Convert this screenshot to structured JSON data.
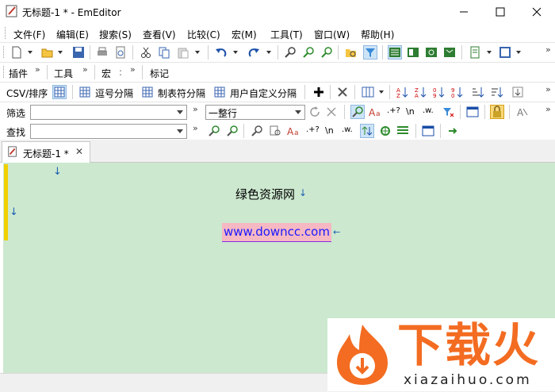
{
  "window": {
    "title": "无标题-1 * - EmEditor"
  },
  "menu": [
    "文件(F)",
    "编辑(E)",
    "搜索(S)",
    "查看(V)",
    "比较(C)",
    "宏(M)",
    "工具(T)",
    "窗口(W)",
    "帮助(H)"
  ],
  "toolbar3": {
    "plugins": "插件",
    "tools": "工具",
    "macro": "宏",
    "marks": "标记"
  },
  "csvbar": {
    "csv_sort": "CSV/排序",
    "comma": "逗号分隔",
    "tab": "制表符分隔",
    "user": "用户自定义分隔"
  },
  "filterbar": {
    "label": "筛选",
    "mode": "一整行"
  },
  "findbar": {
    "label": "查找",
    "regex": ".+?",
    "newline": "\\n",
    "word": ".w."
  },
  "tab": {
    "label": "无标题-1 *",
    "close": "✕"
  },
  "editor": {
    "line1": "绿色资源网",
    "line2": "www.downcc.com"
  },
  "watermark": {
    "brand": "下载火",
    "domain": "xiazaihuo.com"
  },
  "colors": {
    "editor_bg": "#cce8cf",
    "link_highlight": "#f6b8c2",
    "link": "#1a1aff",
    "brand_orange": "#f36c21"
  }
}
